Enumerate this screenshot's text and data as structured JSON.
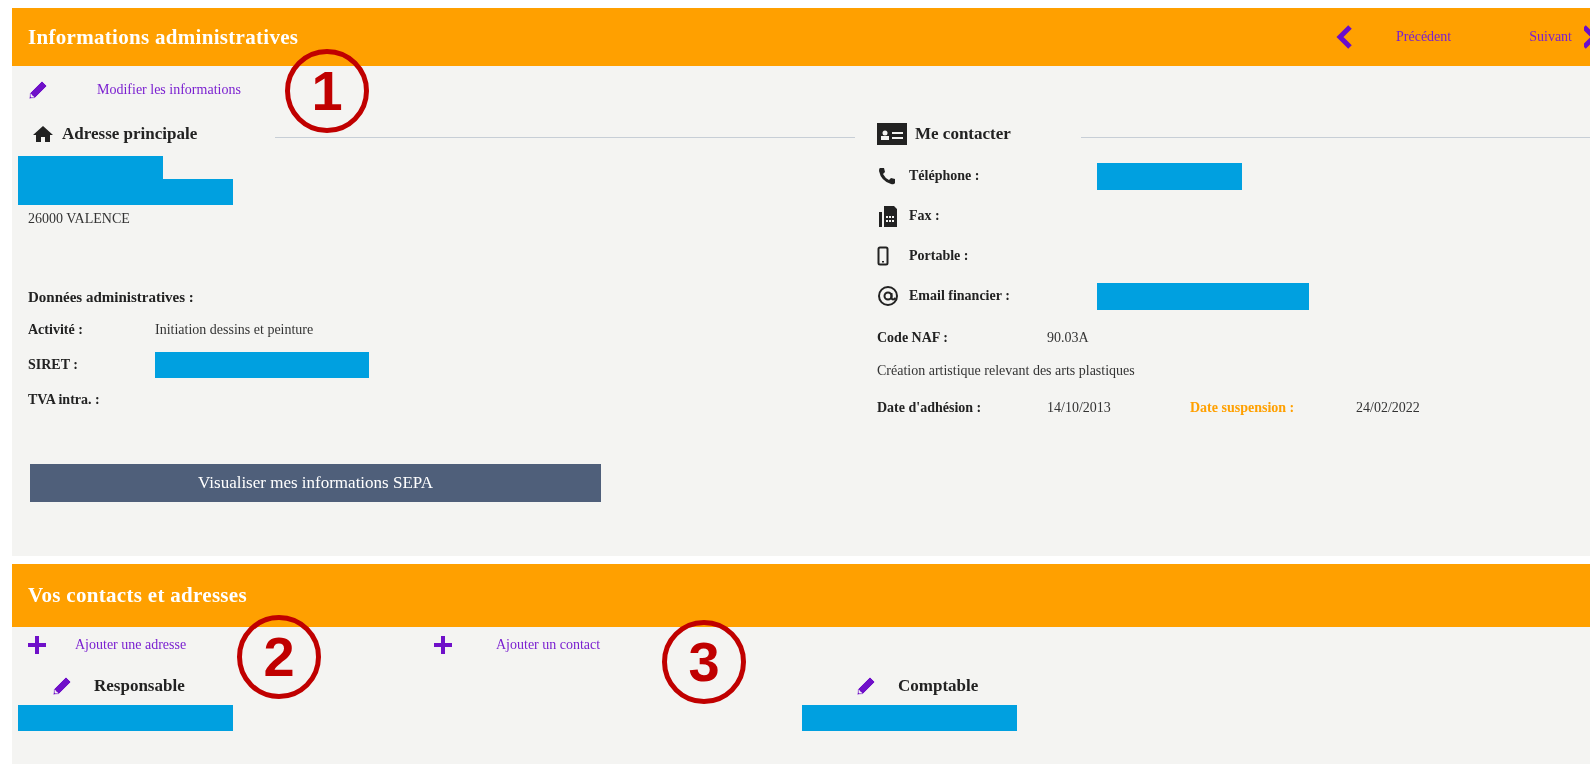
{
  "info": {
    "title": "Informations administratives",
    "prev": "Précédent",
    "next": "Suivant",
    "edit_link": "Modifier les informations",
    "address": {
      "title": "Adresse principale",
      "redacted": true,
      "city": "26000 VALENCE"
    },
    "admin": {
      "title": "Données administratives :",
      "rows": [
        {
          "label": "Activité :",
          "value": "Initiation dessins et peinture",
          "redacted": false
        },
        {
          "label": "SIRET :",
          "redacted": true
        },
        {
          "label": "TVA intra. :",
          "redacted": false
        }
      ]
    },
    "sepa_button": "Visualiser mes informations SEPA",
    "contact": {
      "title": "Me contacter",
      "rows": [
        {
          "label": "Téléphone :",
          "redacted": true
        },
        {
          "label": "Fax :",
          "redacted": false
        },
        {
          "label": "Portable :",
          "redacted": false
        },
        {
          "label": "Email financier :",
          "redacted": true
        }
      ]
    },
    "naf": {
      "label": "Code NAF :",
      "value": "90.03A",
      "description": "Création artistique relevant des arts plastiques"
    },
    "dates": {
      "join_label": "Date d'adhésion :",
      "join_value": "14/10/2013",
      "suspension_label": "Date suspension :",
      "suspension_value": "24/02/2022"
    }
  },
  "contacts": {
    "title": "Vos contacts et adresses",
    "add_address": "Ajouter une adresse",
    "add_contact": "Ajouter un contact",
    "people": [
      {
        "role": "Responsable",
        "redacted": true
      },
      {
        "role": "Comptable",
        "redacted": true
      }
    ]
  },
  "annotations": [
    {
      "label": "1"
    },
    {
      "label": "2"
    },
    {
      "label": "3"
    }
  ]
}
